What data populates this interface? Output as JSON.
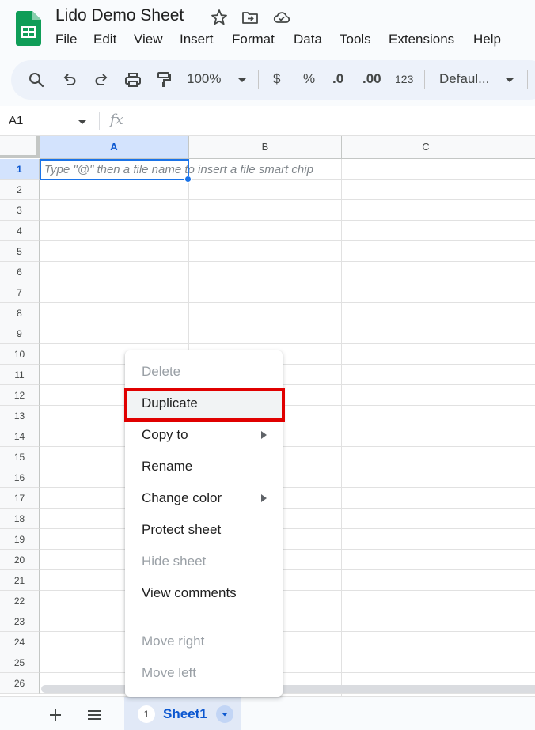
{
  "app": {
    "doc_title": "Lido Demo Sheet",
    "brand_color": "#0f9d58",
    "icons": [
      "sheets-logo-icon",
      "star-icon",
      "move-to-folder-icon",
      "cloud-saved-icon"
    ]
  },
  "menubar": {
    "items": [
      "File",
      "Edit",
      "View",
      "Insert",
      "Format",
      "Data",
      "Tools",
      "Extensions",
      "Help"
    ]
  },
  "toolbar": {
    "zoom": "100%",
    "currency": "$",
    "percent": "%",
    "decrease_decimal": ".0",
    "increase_decimal": ".00",
    "more_formats": "123",
    "font": "Defaul...",
    "icons": [
      "search-icon",
      "undo-icon",
      "redo-icon",
      "print-icon",
      "paint-format-icon"
    ]
  },
  "formula_bar": {
    "name_box": "A1",
    "fx": "fx"
  },
  "grid": {
    "columns": [
      "A",
      "B",
      "C"
    ],
    "selected_column": "A",
    "rows": [
      "1",
      "2",
      "3",
      "4",
      "5",
      "6",
      "7",
      "8",
      "9",
      "10",
      "11",
      "12",
      "13",
      "14",
      "15",
      "16",
      "17",
      "18",
      "19",
      "20",
      "21",
      "22",
      "23",
      "24",
      "25",
      "26"
    ],
    "selected_row": "1",
    "cell_a1_hint": "Type \"@\" then a file name to insert a file smart chip"
  },
  "context_menu": {
    "items": [
      {
        "label": "Delete",
        "disabled": true
      },
      {
        "label": "Duplicate",
        "disabled": false
      },
      {
        "label": "Copy to",
        "disabled": false,
        "submenu": true
      },
      {
        "label": "Rename",
        "disabled": false
      },
      {
        "label": "Change color",
        "disabled": false,
        "submenu": true
      },
      {
        "label": "Protect sheet",
        "disabled": false
      },
      {
        "label": "Hide sheet",
        "disabled": true
      },
      {
        "label": "View comments",
        "disabled": false
      },
      {
        "label": "Move right",
        "disabled": true
      },
      {
        "label": "Move left",
        "disabled": true
      }
    ],
    "highlighted": "Duplicate",
    "highlight_color": "#e00000"
  },
  "sheet_tabs": {
    "tabs": [
      {
        "badge": "1",
        "name": "Sheet1",
        "active": true
      }
    ],
    "active_color": "#0b57d0"
  }
}
